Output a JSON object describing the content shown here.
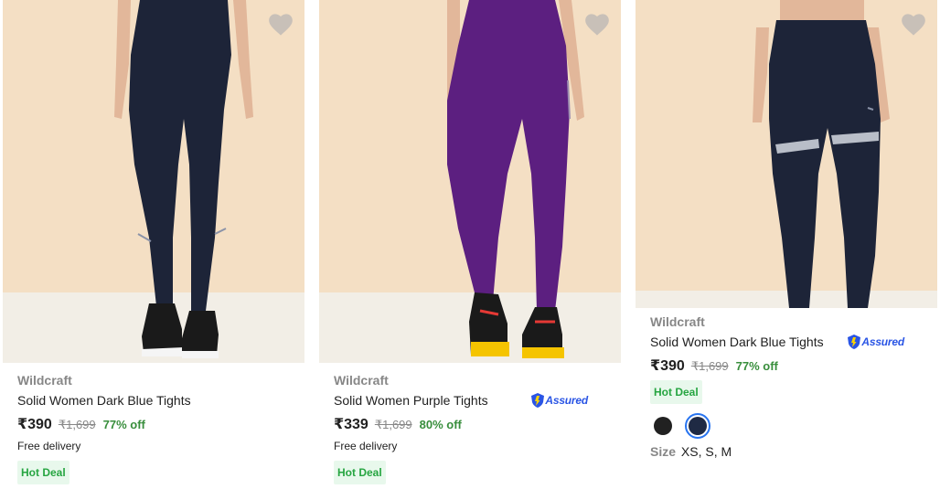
{
  "products": [
    {
      "brand": "Wildcraft",
      "title": "Solid Women Dark Blue Tights",
      "price": "₹390",
      "mrp": "₹1,699",
      "discount": "77% off",
      "delivery": "Free delivery",
      "deal": "Hot Deal",
      "assured": false,
      "tights_color": "#1d2438"
    },
    {
      "brand": "Wildcraft",
      "title": "Solid Women Purple Tights",
      "price": "₹339",
      "mrp": "₹1,699",
      "discount": "80% off",
      "delivery": "Free delivery",
      "deal": "Hot Deal",
      "assured": true,
      "assured_label": "Assured",
      "tights_color": "#5c1f80"
    },
    {
      "brand": "Wildcraft",
      "title": "Solid Women Dark Blue Tights",
      "price": "₹390",
      "mrp": "₹1,699",
      "discount": "77% off",
      "deal": "Hot Deal",
      "assured": true,
      "assured_label": "Assured",
      "tights_color": "#1d2438",
      "swatch_colors": [
        "#212121",
        "#1f2a44"
      ],
      "selected_swatch": 1,
      "size_label": "Size",
      "sizes": "XS, S, M"
    }
  ],
  "colors": {
    "discount": "#388e3c",
    "deal_bg": "#e8f8ec",
    "deal_text": "#26a541",
    "assured_blue": "#2a55e5",
    "muted": "#878787",
    "photo_bg": "#f3dfc6",
    "wishlist_heart": "#c8c0b8"
  },
  "icons": {
    "wishlist": "heart-icon",
    "assured": "shield-check-icon"
  }
}
